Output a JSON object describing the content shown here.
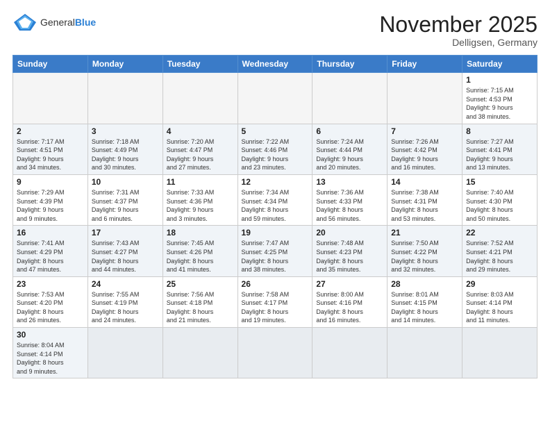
{
  "header": {
    "logo_general": "General",
    "logo_blue": "Blue",
    "month_title": "November 2025",
    "subtitle": "Delligsen, Germany"
  },
  "days_of_week": [
    "Sunday",
    "Monday",
    "Tuesday",
    "Wednesday",
    "Thursday",
    "Friday",
    "Saturday"
  ],
  "weeks": [
    [
      {
        "day": "",
        "info": ""
      },
      {
        "day": "",
        "info": ""
      },
      {
        "day": "",
        "info": ""
      },
      {
        "day": "",
        "info": ""
      },
      {
        "day": "",
        "info": ""
      },
      {
        "day": "",
        "info": ""
      },
      {
        "day": "1",
        "info": "Sunrise: 7:15 AM\nSunset: 4:53 PM\nDaylight: 9 hours\nand 38 minutes."
      }
    ],
    [
      {
        "day": "2",
        "info": "Sunrise: 7:17 AM\nSunset: 4:51 PM\nDaylight: 9 hours\nand 34 minutes."
      },
      {
        "day": "3",
        "info": "Sunrise: 7:18 AM\nSunset: 4:49 PM\nDaylight: 9 hours\nand 30 minutes."
      },
      {
        "day": "4",
        "info": "Sunrise: 7:20 AM\nSunset: 4:47 PM\nDaylight: 9 hours\nand 27 minutes."
      },
      {
        "day": "5",
        "info": "Sunrise: 7:22 AM\nSunset: 4:46 PM\nDaylight: 9 hours\nand 23 minutes."
      },
      {
        "day": "6",
        "info": "Sunrise: 7:24 AM\nSunset: 4:44 PM\nDaylight: 9 hours\nand 20 minutes."
      },
      {
        "day": "7",
        "info": "Sunrise: 7:26 AM\nSunset: 4:42 PM\nDaylight: 9 hours\nand 16 minutes."
      },
      {
        "day": "8",
        "info": "Sunrise: 7:27 AM\nSunset: 4:41 PM\nDaylight: 9 hours\nand 13 minutes."
      }
    ],
    [
      {
        "day": "9",
        "info": "Sunrise: 7:29 AM\nSunset: 4:39 PM\nDaylight: 9 hours\nand 9 minutes."
      },
      {
        "day": "10",
        "info": "Sunrise: 7:31 AM\nSunset: 4:37 PM\nDaylight: 9 hours\nand 6 minutes."
      },
      {
        "day": "11",
        "info": "Sunrise: 7:33 AM\nSunset: 4:36 PM\nDaylight: 9 hours\nand 3 minutes."
      },
      {
        "day": "12",
        "info": "Sunrise: 7:34 AM\nSunset: 4:34 PM\nDaylight: 8 hours\nand 59 minutes."
      },
      {
        "day": "13",
        "info": "Sunrise: 7:36 AM\nSunset: 4:33 PM\nDaylight: 8 hours\nand 56 minutes."
      },
      {
        "day": "14",
        "info": "Sunrise: 7:38 AM\nSunset: 4:31 PM\nDaylight: 8 hours\nand 53 minutes."
      },
      {
        "day": "15",
        "info": "Sunrise: 7:40 AM\nSunset: 4:30 PM\nDaylight: 8 hours\nand 50 minutes."
      }
    ],
    [
      {
        "day": "16",
        "info": "Sunrise: 7:41 AM\nSunset: 4:29 PM\nDaylight: 8 hours\nand 47 minutes."
      },
      {
        "day": "17",
        "info": "Sunrise: 7:43 AM\nSunset: 4:27 PM\nDaylight: 8 hours\nand 44 minutes."
      },
      {
        "day": "18",
        "info": "Sunrise: 7:45 AM\nSunset: 4:26 PM\nDaylight: 8 hours\nand 41 minutes."
      },
      {
        "day": "19",
        "info": "Sunrise: 7:47 AM\nSunset: 4:25 PM\nDaylight: 8 hours\nand 38 minutes."
      },
      {
        "day": "20",
        "info": "Sunrise: 7:48 AM\nSunset: 4:23 PM\nDaylight: 8 hours\nand 35 minutes."
      },
      {
        "day": "21",
        "info": "Sunrise: 7:50 AM\nSunset: 4:22 PM\nDaylight: 8 hours\nand 32 minutes."
      },
      {
        "day": "22",
        "info": "Sunrise: 7:52 AM\nSunset: 4:21 PM\nDaylight: 8 hours\nand 29 minutes."
      }
    ],
    [
      {
        "day": "23",
        "info": "Sunrise: 7:53 AM\nSunset: 4:20 PM\nDaylight: 8 hours\nand 26 minutes."
      },
      {
        "day": "24",
        "info": "Sunrise: 7:55 AM\nSunset: 4:19 PM\nDaylight: 8 hours\nand 24 minutes."
      },
      {
        "day": "25",
        "info": "Sunrise: 7:56 AM\nSunset: 4:18 PM\nDaylight: 8 hours\nand 21 minutes."
      },
      {
        "day": "26",
        "info": "Sunrise: 7:58 AM\nSunset: 4:17 PM\nDaylight: 8 hours\nand 19 minutes."
      },
      {
        "day": "27",
        "info": "Sunrise: 8:00 AM\nSunset: 4:16 PM\nDaylight: 8 hours\nand 16 minutes."
      },
      {
        "day": "28",
        "info": "Sunrise: 8:01 AM\nSunset: 4:15 PM\nDaylight: 8 hours\nand 14 minutes."
      },
      {
        "day": "29",
        "info": "Sunrise: 8:03 AM\nSunset: 4:14 PM\nDaylight: 8 hours\nand 11 minutes."
      }
    ],
    [
      {
        "day": "30",
        "info": "Sunrise: 8:04 AM\nSunset: 4:14 PM\nDaylight: 8 hours\nand 9 minutes."
      },
      {
        "day": "",
        "info": ""
      },
      {
        "day": "",
        "info": ""
      },
      {
        "day": "",
        "info": ""
      },
      {
        "day": "",
        "info": ""
      },
      {
        "day": "",
        "info": ""
      },
      {
        "day": "",
        "info": ""
      }
    ]
  ]
}
